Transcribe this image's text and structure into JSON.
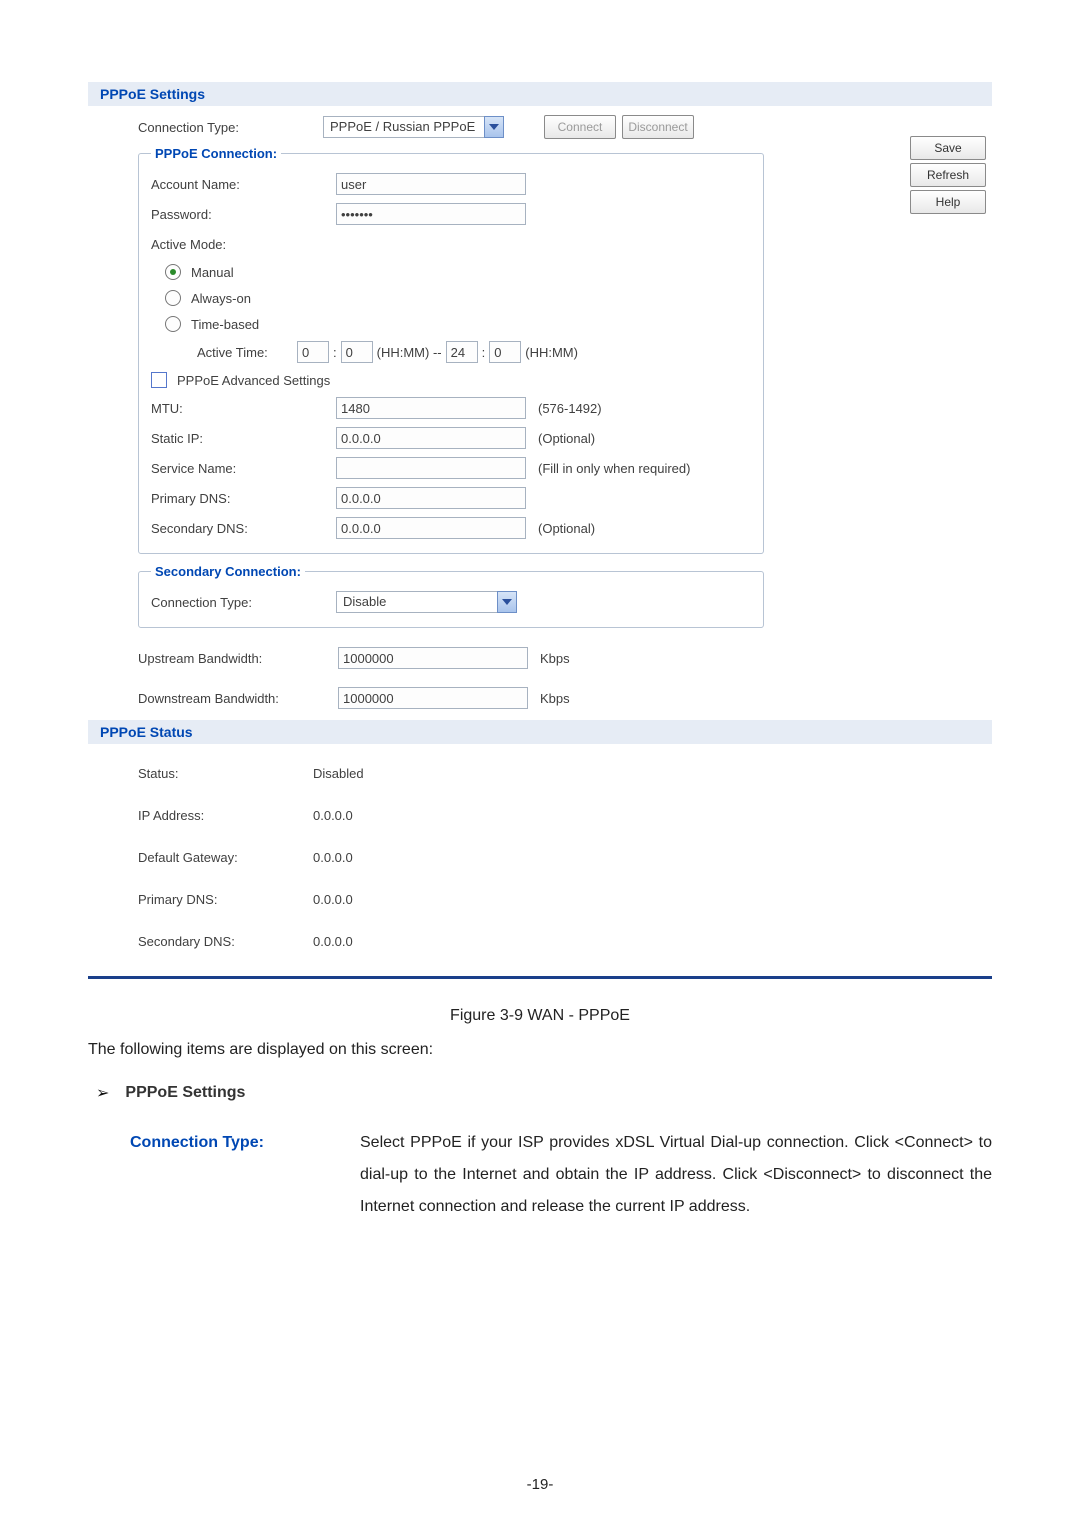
{
  "sections": {
    "settings_header": "PPPoE Settings",
    "status_header": "PPPoE Status"
  },
  "buttons": {
    "connect": "Connect",
    "disconnect": "Disconnect",
    "save": "Save",
    "refresh": "Refresh",
    "help": "Help"
  },
  "pppoe": {
    "conn_type_label": "Connection Type:",
    "conn_type_value": "PPPoE / Russian PPPoE",
    "legend": "PPPoE Connection:",
    "account_label": "Account Name:",
    "account_value": "user",
    "password_label": "Password:",
    "password_value": "•••••••",
    "active_mode_label": "Active Mode:",
    "mode_manual": "Manual",
    "mode_always": "Always-on",
    "mode_time": "Time-based",
    "active_time_label": "Active Time:",
    "t1h": "0",
    "t1m": "0",
    "t2h": "24",
    "t2m": "0",
    "hhmm": "(HH:MM)",
    "hhmm_dash": "(HH:MM) --",
    "adv_label": "PPPoE Advanced Settings",
    "mtu_label": "MTU:",
    "mtu_value": "1480",
    "mtu_hint": "(576-1492)",
    "static_ip_label": "Static IP:",
    "static_ip_value": "0.0.0.0",
    "optional": "(Optional)",
    "service_label": "Service Name:",
    "service_value": "",
    "service_hint": "(Fill in only when required)",
    "pdns_label": "Primary DNS:",
    "pdns_value": "0.0.0.0",
    "sdns_label": "Secondary DNS:",
    "sdns_value": "0.0.0.0"
  },
  "secondary": {
    "legend": "Secondary Connection:",
    "conn_type_label": "Connection Type:",
    "conn_type_value": "Disable"
  },
  "bandwidth": {
    "up_label": "Upstream Bandwidth:",
    "up_value": "1000000",
    "down_label": "Downstream Bandwidth:",
    "down_value": "1000000",
    "unit": "Kbps"
  },
  "status": {
    "status_label": "Status:",
    "status_value": "Disabled",
    "ip_label": "IP Address:",
    "ip_value": "0.0.0.0",
    "gw_label": "Default Gateway:",
    "gw_value": "0.0.0.0",
    "pdns_label": "Primary DNS:",
    "pdns_value": "0.0.0.0",
    "sdns_label": "Secondary DNS:",
    "sdns_value": "0.0.0.0"
  },
  "figure_caption": "Figure 3-9 WAN - PPPoE",
  "intro_text": "The following items are displayed on this screen:",
  "bullet1": "PPPoE Settings",
  "desc_label": "Connection Type:",
  "desc_body": "Select PPPoE if your ISP provides xDSL Virtual Dial-up connection. Click <Connect> to dial-up to the Internet and obtain the IP address. Click <Disconnect> to disconnect the Internet connection and release the current IP address.",
  "page_number": "-19-"
}
